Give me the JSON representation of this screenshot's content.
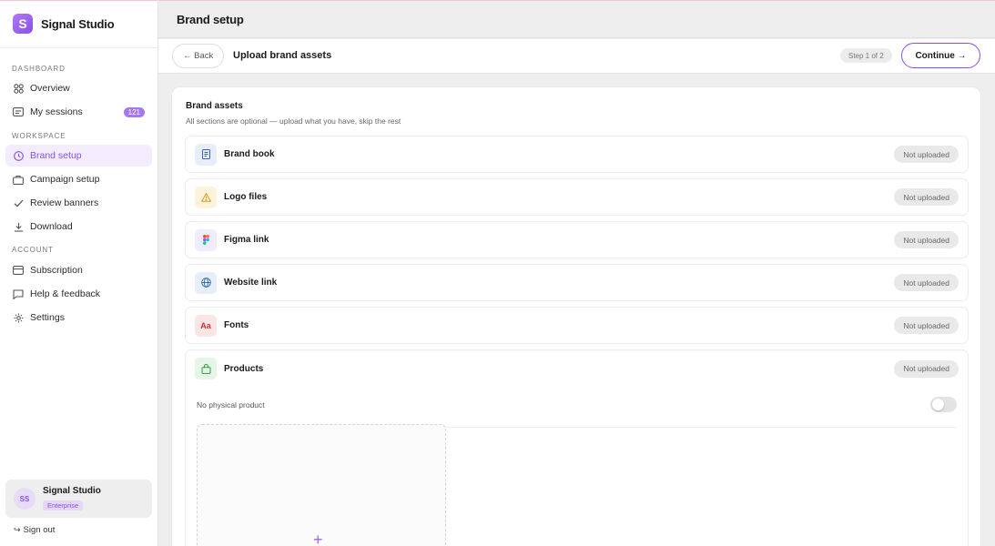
{
  "brand": {
    "name": "Signal Studio",
    "logo_glyph": "S",
    "accent": "#8a4fe8"
  },
  "sidebar": {
    "dashboard_heading": "DASHBOARD",
    "workspace_heading": "WORKSPACE",
    "account_heading": "ACCOUNT",
    "items": [
      {
        "label": "Overview",
        "icon": "grid-icon"
      },
      {
        "label": "My sessions",
        "icon": "sessions-icon",
        "badge": "121"
      },
      {
        "label": "Brand setup",
        "icon": "clock-icon",
        "active": true
      },
      {
        "label": "Campaign setup",
        "icon": "briefcase-icon"
      },
      {
        "label": "Review banners",
        "icon": "check-icon"
      },
      {
        "label": "Download",
        "icon": "download-icon"
      },
      {
        "label": "Subscription",
        "icon": "card-icon"
      },
      {
        "label": "Help & feedback",
        "icon": "chat-icon"
      },
      {
        "label": "Settings",
        "icon": "gear-icon"
      }
    ],
    "account": {
      "initials": "SS",
      "name": "Signal Studio",
      "plan": "Enterprise"
    },
    "sign_out": "Sign out"
  },
  "header": {
    "title": "Brand setup"
  },
  "subbar": {
    "back": "← Back",
    "title": "Upload brand assets",
    "step": "Step 1 of 2",
    "continue": "Continue →"
  },
  "assets": {
    "title": "Brand assets",
    "subtitle": "All sections are optional — upload what you have, skip the rest",
    "rows": [
      {
        "label": "Brand book",
        "status": "Not uploaded",
        "icon": "document-icon"
      },
      {
        "label": "Logo files",
        "status": "Not uploaded",
        "icon": "warning-icon"
      },
      {
        "label": "Figma link",
        "status": "Not uploaded",
        "icon": "figma-icon"
      },
      {
        "label": "Website link",
        "status": "Not uploaded",
        "icon": "globe-icon"
      },
      {
        "label": "Fonts",
        "status": "Not uploaded",
        "icon": "font-icon",
        "glyph": "Aa"
      },
      {
        "label": "Products",
        "status": "Not uploaded",
        "icon": "bag-icon"
      }
    ],
    "toggle_label": "No physical product",
    "toggle_on": false,
    "upload_plus": "+"
  }
}
